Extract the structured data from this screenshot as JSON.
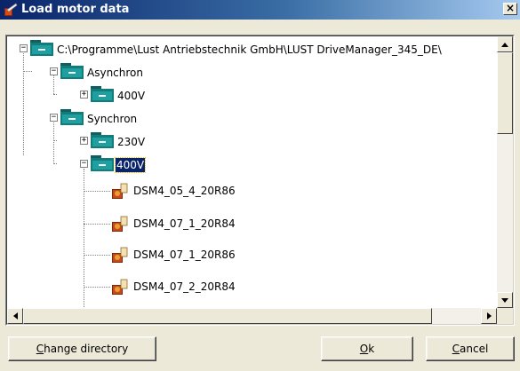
{
  "window": {
    "title": "Load motor data",
    "close_symbol": "×"
  },
  "tree": {
    "root": {
      "label": "C:\\Programme\\Lust Antriebstechnik GmbH\\LUST DriveManager_345_DE\\"
    },
    "asynchron": {
      "label": "Asynchron"
    },
    "asynchron_400v": {
      "label": "400V"
    },
    "synchron": {
      "label": "Synchron"
    },
    "synchron_230v": {
      "label": "230V"
    },
    "synchron_400v": {
      "label": "400V"
    },
    "motors": [
      {
        "label": "DSM4_05_4_20R86"
      },
      {
        "label": "DSM4_07_1_20R84"
      },
      {
        "label": "DSM4_07_1_20R86"
      },
      {
        "label": "DSM4_07_2_20R84"
      }
    ]
  },
  "expanders": {
    "expanded": "−",
    "collapsed": "+"
  },
  "buttons": {
    "change_directory": {
      "access_key": "C",
      "rest": "hange directory"
    },
    "ok": {
      "access_key": "O",
      "rest": "k"
    },
    "cancel": {
      "access_key": "C",
      "rest": "ancel"
    }
  },
  "colors": {
    "title_bar_start": "#0a246a",
    "title_bar_end": "#a6caf0",
    "folder": "#1a8a8a",
    "selection": "#0a246a",
    "face": "#ece9d8"
  },
  "icons": {
    "title": "motor-app-icon",
    "folder": "teal-folder-icon",
    "motor": "motor-file-icon"
  }
}
